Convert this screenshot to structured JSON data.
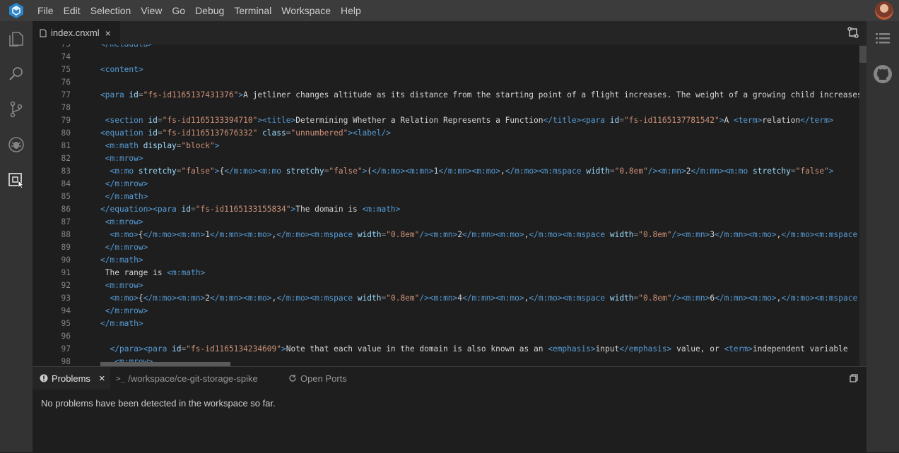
{
  "menu": [
    "File",
    "Edit",
    "Selection",
    "View",
    "Go",
    "Debug",
    "Terminal",
    "Workspace",
    "Help"
  ],
  "tab": {
    "label": "index.cnxml",
    "close": "×"
  },
  "panel": {
    "problems": "Problems",
    "close": "×",
    "terminal": "/workspace/ce-git-storage-spike",
    "ports": "Open Ports",
    "message": "No problems have been detected in the workspace so far."
  },
  "lines": [
    {
      "n": "73",
      "t": [
        [
          "tg",
          "</metadata>"
        ]
      ]
    },
    {
      "n": "74",
      "t": []
    },
    {
      "n": "75",
      "t": [
        [
          "tg",
          "<content>"
        ]
      ]
    },
    {
      "n": "76",
      "t": []
    },
    {
      "n": "77",
      "t": [
        [
          "tg",
          "<para "
        ],
        [
          "at",
          "id"
        ],
        [
          "pu",
          "="
        ],
        [
          "sv",
          "\"fs-id1165137431376\""
        ],
        [
          "tg",
          ">"
        ],
        [
          "tx",
          "A jetliner changes altitude as its distance from the starting point of a flight increases. The weight of a growing child increases with time. In each case,"
        ]
      ]
    },
    {
      "n": "78",
      "t": []
    },
    {
      "n": "79",
      "t": [
        [
          "tx",
          " "
        ],
        [
          "tg",
          "<section "
        ],
        [
          "at",
          "id"
        ],
        [
          "pu",
          "="
        ],
        [
          "sv",
          "\"fs-id1165133394710\""
        ],
        [
          "tg",
          "><title>"
        ],
        [
          "tx",
          "Determining Whether a Relation Represents a Function"
        ],
        [
          "tg",
          "</title><para "
        ],
        [
          "at",
          "id"
        ],
        [
          "pu",
          "="
        ],
        [
          "sv",
          "\"fs-id1165137781542\""
        ],
        [
          "tg",
          ">"
        ],
        [
          "tx",
          "A "
        ],
        [
          "tg",
          "<term>"
        ],
        [
          "tx",
          "relation"
        ],
        [
          "tg",
          "</term>"
        ]
      ]
    },
    {
      "n": "80",
      "t": [
        [
          "tg",
          "<equation "
        ],
        [
          "at",
          "id"
        ],
        [
          "pu",
          "="
        ],
        [
          "sv",
          "\"fs-id1165137676332\""
        ],
        [
          "tx",
          " "
        ],
        [
          "at",
          "class"
        ],
        [
          "pu",
          "="
        ],
        [
          "sv",
          "\"unnumbered\""
        ],
        [
          "tg",
          "><label/>"
        ]
      ]
    },
    {
      "n": "81",
      "t": [
        [
          "tx",
          " "
        ],
        [
          "tg",
          "<m:math "
        ],
        [
          "at",
          "display"
        ],
        [
          "pu",
          "="
        ],
        [
          "sv",
          "\"block\""
        ],
        [
          "tg",
          ">"
        ]
      ]
    },
    {
      "n": "82",
      "t": [
        [
          "tx",
          " "
        ],
        [
          "tg",
          "<m:mrow>"
        ]
      ]
    },
    {
      "n": "83",
      "t": [
        [
          "tx",
          "  "
        ],
        [
          "tg",
          "<m:mo "
        ],
        [
          "at",
          "stretchy"
        ],
        [
          "pu",
          "="
        ],
        [
          "sv",
          "\"false\""
        ],
        [
          "tg",
          ">"
        ],
        [
          "tx",
          "{"
        ],
        [
          "tg",
          "</m:mo><m:mo "
        ],
        [
          "at",
          "stretchy"
        ],
        [
          "pu",
          "="
        ],
        [
          "sv",
          "\"false\""
        ],
        [
          "tg",
          ">"
        ],
        [
          "tx",
          "("
        ],
        [
          "tg",
          "</m:mo><m:mn>"
        ],
        [
          "tx",
          "1"
        ],
        [
          "tg",
          "</m:mn><m:mo>"
        ],
        [
          "tx",
          ","
        ],
        [
          "tg",
          "</m:mo><m:mspace "
        ],
        [
          "at",
          "width"
        ],
        [
          "pu",
          "="
        ],
        [
          "sv",
          "\"0.8em\""
        ],
        [
          "tg",
          "/><m:mn>"
        ],
        [
          "tx",
          "2"
        ],
        [
          "tg",
          "</m:mn><m:mo "
        ],
        [
          "at",
          "stretchy"
        ],
        [
          "pu",
          "="
        ],
        [
          "sv",
          "\"false\""
        ],
        [
          "tg",
          ">"
        ]
      ]
    },
    {
      "n": "84",
      "t": [
        [
          "tx",
          " "
        ],
        [
          "tg",
          "</m:mrow>"
        ]
      ]
    },
    {
      "n": "85",
      "t": [
        [
          "tx",
          " "
        ],
        [
          "tg",
          "</m:math>"
        ]
      ]
    },
    {
      "n": "86",
      "t": [
        [
          "tg",
          "</equation><para "
        ],
        [
          "at",
          "id"
        ],
        [
          "pu",
          "="
        ],
        [
          "sv",
          "\"fs-id1165133155834\""
        ],
        [
          "tg",
          ">"
        ],
        [
          "tx",
          "The domain is "
        ],
        [
          "tg",
          "<m:math>"
        ]
      ]
    },
    {
      "n": "87",
      "t": [
        [
          "tx",
          " "
        ],
        [
          "tg",
          "<m:mrow>"
        ]
      ]
    },
    {
      "n": "88",
      "t": [
        [
          "tx",
          "  "
        ],
        [
          "tg",
          "<m:mo>"
        ],
        [
          "tx",
          "{"
        ],
        [
          "tg",
          "</m:mo><m:mn>"
        ],
        [
          "tx",
          "1"
        ],
        [
          "tg",
          "</m:mn><m:mo>"
        ],
        [
          "tx",
          ","
        ],
        [
          "tg",
          "</m:mo><m:mspace "
        ],
        [
          "at",
          "width"
        ],
        [
          "pu",
          "="
        ],
        [
          "sv",
          "\"0.8em\""
        ],
        [
          "tg",
          "/><m:mn>"
        ],
        [
          "tx",
          "2"
        ],
        [
          "tg",
          "</m:mn><m:mo>"
        ],
        [
          "tx",
          ","
        ],
        [
          "tg",
          "</m:mo><m:mspace "
        ],
        [
          "at",
          "width"
        ],
        [
          "pu",
          "="
        ],
        [
          "sv",
          "\"0.8em\""
        ],
        [
          "tg",
          "/><m:mn>"
        ],
        [
          "tx",
          "3"
        ],
        [
          "tg",
          "</m:mn><m:mo>"
        ],
        [
          "tx",
          ","
        ],
        [
          "tg",
          "</m:mo><m:mspace"
        ]
      ]
    },
    {
      "n": "89",
      "t": [
        [
          "tx",
          " "
        ],
        [
          "tg",
          "</m:mrow>"
        ]
      ]
    },
    {
      "n": "90",
      "t": [
        [
          "tg",
          "</m:math>"
        ]
      ]
    },
    {
      "n": "91",
      "t": [
        [
          "tx",
          " The range is "
        ],
        [
          "tg",
          "<m:math>"
        ]
      ]
    },
    {
      "n": "92",
      "t": [
        [
          "tx",
          " "
        ],
        [
          "tg",
          "<m:mrow>"
        ]
      ]
    },
    {
      "n": "93",
      "t": [
        [
          "tx",
          "  "
        ],
        [
          "tg",
          "<m:mo>"
        ],
        [
          "tx",
          "{"
        ],
        [
          "tg",
          "</m:mo><m:mn>"
        ],
        [
          "tx",
          "2"
        ],
        [
          "tg",
          "</m:mn><m:mo>"
        ],
        [
          "tx",
          ","
        ],
        [
          "tg",
          "</m:mo><m:mspace "
        ],
        [
          "at",
          "width"
        ],
        [
          "pu",
          "="
        ],
        [
          "sv",
          "\"0.8em\""
        ],
        [
          "tg",
          "/><m:mn>"
        ],
        [
          "tx",
          "4"
        ],
        [
          "tg",
          "</m:mn><m:mo>"
        ],
        [
          "tx",
          ","
        ],
        [
          "tg",
          "</m:mo><m:mspace "
        ],
        [
          "at",
          "width"
        ],
        [
          "pu",
          "="
        ],
        [
          "sv",
          "\"0.8em\""
        ],
        [
          "tg",
          "/><m:mn>"
        ],
        [
          "tx",
          "6"
        ],
        [
          "tg",
          "</m:mn><m:mo>"
        ],
        [
          "tx",
          ","
        ],
        [
          "tg",
          "</m:mo><m:mspace"
        ]
      ]
    },
    {
      "n": "94",
      "t": [
        [
          "tx",
          " "
        ],
        [
          "tg",
          "</m:mrow>"
        ]
      ]
    },
    {
      "n": "95",
      "t": [
        [
          "tg",
          "</m:math>"
        ]
      ]
    },
    {
      "n": "96",
      "t": []
    },
    {
      "n": "97",
      "t": [
        [
          "tx",
          "  "
        ],
        [
          "tg",
          "</para><para "
        ],
        [
          "at",
          "id"
        ],
        [
          "pu",
          "="
        ],
        [
          "sv",
          "\"fs-id1165134234609\""
        ],
        [
          "tg",
          ">"
        ],
        [
          "tx",
          "Note that each value in the domain is also known as an "
        ],
        [
          "tg",
          "<emphasis>"
        ],
        [
          "tx",
          "input"
        ],
        [
          "tg",
          "</emphasis>"
        ],
        [
          "tx",
          " value, or "
        ],
        [
          "tg",
          "<term>"
        ],
        [
          "tx",
          "independent variable"
        ]
      ]
    },
    {
      "n": "98",
      "t": [
        [
          "tx",
          "   "
        ],
        [
          "tg",
          "<m:mrow>"
        ]
      ]
    }
  ]
}
